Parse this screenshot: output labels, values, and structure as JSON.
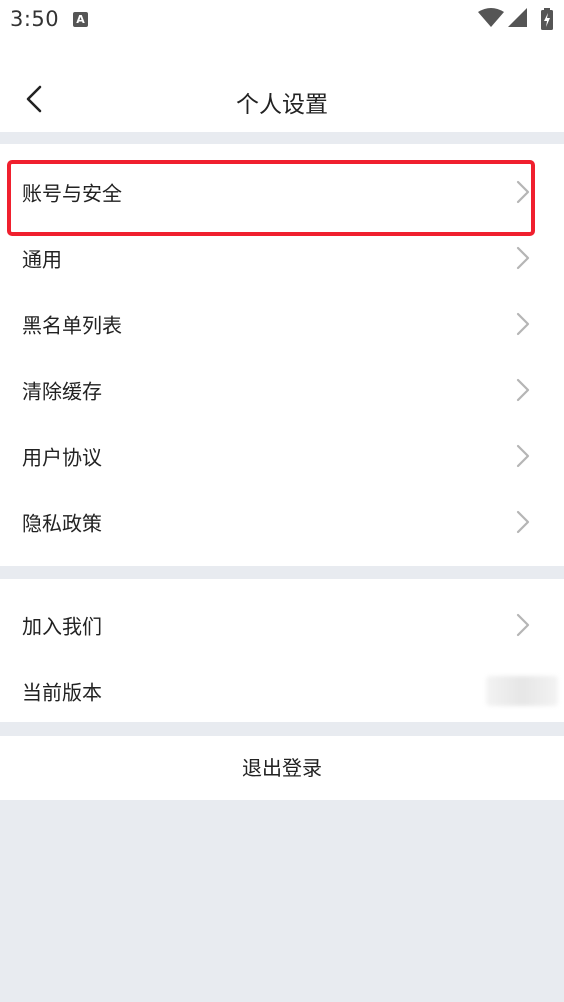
{
  "status_bar": {
    "time": "3:50",
    "notification_icon": "A",
    "icons": [
      "wifi-icon",
      "signal-icon",
      "battery-charging-icon"
    ]
  },
  "header": {
    "title": "个人设置",
    "back_icon": "chevron-left-icon"
  },
  "group1": [
    {
      "label": "账号与安全",
      "icon": "chevron-right-icon"
    },
    {
      "label": "通用",
      "icon": "chevron-right-icon"
    },
    {
      "label": "黑名单列表",
      "icon": "chevron-right-icon"
    },
    {
      "label": "清除缓存",
      "icon": "chevron-right-icon"
    },
    {
      "label": "用户协议",
      "icon": "chevron-right-icon"
    },
    {
      "label": "隐私政策",
      "icon": "chevron-right-icon"
    }
  ],
  "group2": [
    {
      "label": "加入我们",
      "icon": "chevron-right-icon"
    },
    {
      "label": "当前版本"
    }
  ],
  "logout": {
    "label": "退出登录"
  },
  "colors": {
    "background": "#e8ebf0",
    "card": "#ffffff",
    "highlight": "#f0202e",
    "chevron": "#b5b5b5"
  }
}
